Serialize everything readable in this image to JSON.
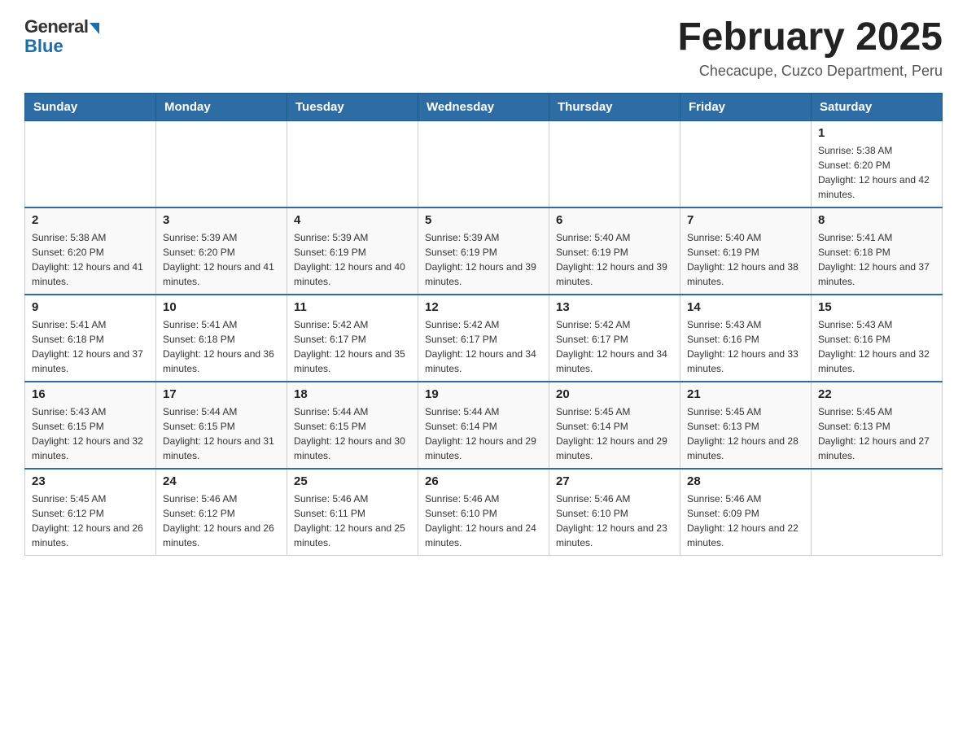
{
  "logo": {
    "general": "General",
    "blue": "Blue"
  },
  "header": {
    "title": "February 2025",
    "location": "Checacupe, Cuzco Department, Peru"
  },
  "days_of_week": [
    "Sunday",
    "Monday",
    "Tuesday",
    "Wednesday",
    "Thursday",
    "Friday",
    "Saturday"
  ],
  "weeks": [
    [
      {
        "day": "",
        "info": ""
      },
      {
        "day": "",
        "info": ""
      },
      {
        "day": "",
        "info": ""
      },
      {
        "day": "",
        "info": ""
      },
      {
        "day": "",
        "info": ""
      },
      {
        "day": "",
        "info": ""
      },
      {
        "day": "1",
        "info": "Sunrise: 5:38 AM\nSunset: 6:20 PM\nDaylight: 12 hours and 42 minutes."
      }
    ],
    [
      {
        "day": "2",
        "info": "Sunrise: 5:38 AM\nSunset: 6:20 PM\nDaylight: 12 hours and 41 minutes."
      },
      {
        "day": "3",
        "info": "Sunrise: 5:39 AM\nSunset: 6:20 PM\nDaylight: 12 hours and 41 minutes."
      },
      {
        "day": "4",
        "info": "Sunrise: 5:39 AM\nSunset: 6:19 PM\nDaylight: 12 hours and 40 minutes."
      },
      {
        "day": "5",
        "info": "Sunrise: 5:39 AM\nSunset: 6:19 PM\nDaylight: 12 hours and 39 minutes."
      },
      {
        "day": "6",
        "info": "Sunrise: 5:40 AM\nSunset: 6:19 PM\nDaylight: 12 hours and 39 minutes."
      },
      {
        "day": "7",
        "info": "Sunrise: 5:40 AM\nSunset: 6:19 PM\nDaylight: 12 hours and 38 minutes."
      },
      {
        "day": "8",
        "info": "Sunrise: 5:41 AM\nSunset: 6:18 PM\nDaylight: 12 hours and 37 minutes."
      }
    ],
    [
      {
        "day": "9",
        "info": "Sunrise: 5:41 AM\nSunset: 6:18 PM\nDaylight: 12 hours and 37 minutes."
      },
      {
        "day": "10",
        "info": "Sunrise: 5:41 AM\nSunset: 6:18 PM\nDaylight: 12 hours and 36 minutes."
      },
      {
        "day": "11",
        "info": "Sunrise: 5:42 AM\nSunset: 6:17 PM\nDaylight: 12 hours and 35 minutes."
      },
      {
        "day": "12",
        "info": "Sunrise: 5:42 AM\nSunset: 6:17 PM\nDaylight: 12 hours and 34 minutes."
      },
      {
        "day": "13",
        "info": "Sunrise: 5:42 AM\nSunset: 6:17 PM\nDaylight: 12 hours and 34 minutes."
      },
      {
        "day": "14",
        "info": "Sunrise: 5:43 AM\nSunset: 6:16 PM\nDaylight: 12 hours and 33 minutes."
      },
      {
        "day": "15",
        "info": "Sunrise: 5:43 AM\nSunset: 6:16 PM\nDaylight: 12 hours and 32 minutes."
      }
    ],
    [
      {
        "day": "16",
        "info": "Sunrise: 5:43 AM\nSunset: 6:15 PM\nDaylight: 12 hours and 32 minutes."
      },
      {
        "day": "17",
        "info": "Sunrise: 5:44 AM\nSunset: 6:15 PM\nDaylight: 12 hours and 31 minutes."
      },
      {
        "day": "18",
        "info": "Sunrise: 5:44 AM\nSunset: 6:15 PM\nDaylight: 12 hours and 30 minutes."
      },
      {
        "day": "19",
        "info": "Sunrise: 5:44 AM\nSunset: 6:14 PM\nDaylight: 12 hours and 29 minutes."
      },
      {
        "day": "20",
        "info": "Sunrise: 5:45 AM\nSunset: 6:14 PM\nDaylight: 12 hours and 29 minutes."
      },
      {
        "day": "21",
        "info": "Sunrise: 5:45 AM\nSunset: 6:13 PM\nDaylight: 12 hours and 28 minutes."
      },
      {
        "day": "22",
        "info": "Sunrise: 5:45 AM\nSunset: 6:13 PM\nDaylight: 12 hours and 27 minutes."
      }
    ],
    [
      {
        "day": "23",
        "info": "Sunrise: 5:45 AM\nSunset: 6:12 PM\nDaylight: 12 hours and 26 minutes."
      },
      {
        "day": "24",
        "info": "Sunrise: 5:46 AM\nSunset: 6:12 PM\nDaylight: 12 hours and 26 minutes."
      },
      {
        "day": "25",
        "info": "Sunrise: 5:46 AM\nSunset: 6:11 PM\nDaylight: 12 hours and 25 minutes."
      },
      {
        "day": "26",
        "info": "Sunrise: 5:46 AM\nSunset: 6:10 PM\nDaylight: 12 hours and 24 minutes."
      },
      {
        "day": "27",
        "info": "Sunrise: 5:46 AM\nSunset: 6:10 PM\nDaylight: 12 hours and 23 minutes."
      },
      {
        "day": "28",
        "info": "Sunrise: 5:46 AM\nSunset: 6:09 PM\nDaylight: 12 hours and 22 minutes."
      },
      {
        "day": "",
        "info": ""
      }
    ]
  ]
}
